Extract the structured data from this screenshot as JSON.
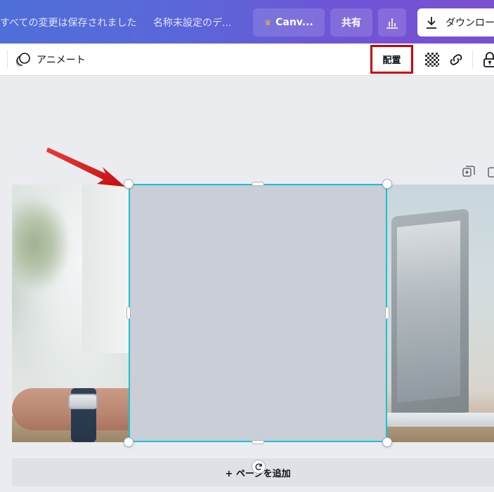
{
  "topbar": {
    "saved_status": "すべての変更は保存されました",
    "doc_title": "名称未設定のデ...",
    "canva_pro_label": "Canv...",
    "share_label": "共有",
    "download_label": "ダウンロー"
  },
  "toolbar": {
    "animate_label": "アニメート",
    "arrange_label": "配置"
  },
  "canvas": {
    "add_page_label": "+ ページを追加"
  },
  "colors": {
    "topbar_gradient_start": "#4f6fd8",
    "topbar_gradient_end": "#7b4fd2",
    "selection": "#14c3d6",
    "frame_fill": "#c9ced7",
    "highlight_box": "#cc0000",
    "annotation_arrow": "#e01b1b"
  },
  "icons": {
    "animate": "animate-circles-icon",
    "transparency": "transparency-checker-icon",
    "link": "link-icon",
    "lock": "lock-icon",
    "insights": "bar-chart-icon",
    "download": "download-arrow-icon",
    "crown": "crown-icon",
    "duplicate_page": "duplicate-page-icon",
    "add_page": "add-page-icon",
    "rotate": "rotate-icon"
  }
}
